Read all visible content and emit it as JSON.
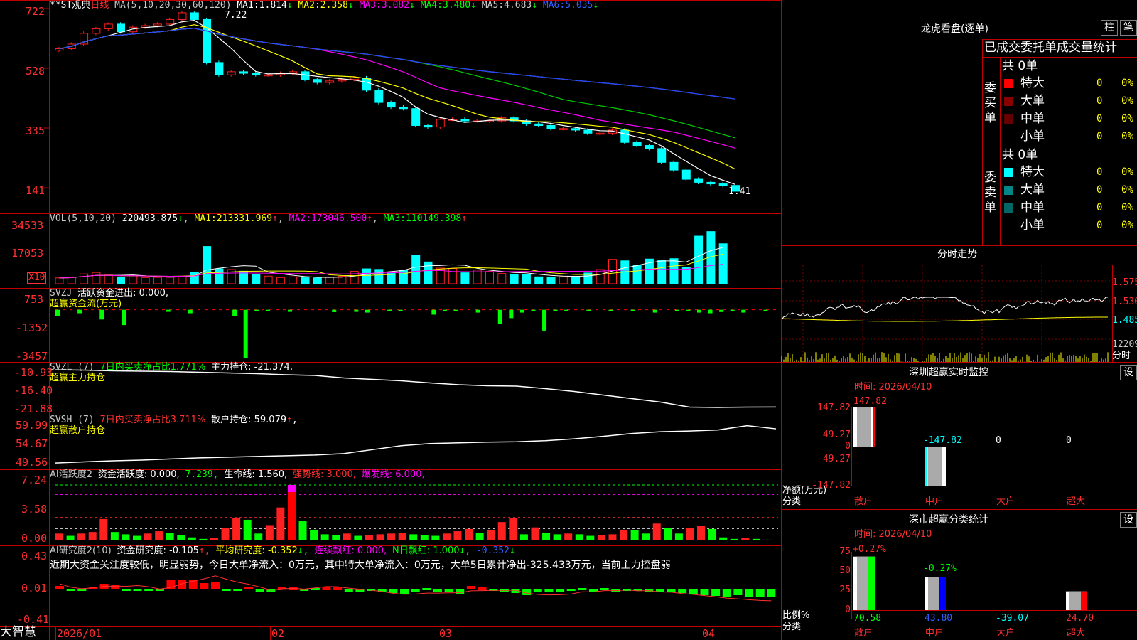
{
  "colors": {
    "up": "#ff2020",
    "down": "#00ffff",
    "vol_down": "#00ffff",
    "ma1": "#ffffff",
    "ma2": "#ffff00",
    "ma3": "#ff00ff",
    "ma4": "#00cc00",
    "ma5": "#c0c0c0",
    "ma6": "#2040ff",
    "grid": "#b00000",
    "pos": "#ff0000",
    "neg": "#00ff00"
  },
  "price_panel": {
    "stock": "**ST观典",
    "period": "日线",
    "ma_params": "MA(5,10,20,30,60,120)",
    "ma": [
      {
        "label": "MA1:",
        "value": "1.814",
        "arrow": "↓"
      },
      {
        "label": "MA2:",
        "value": "2.358",
        "arrow": "↓"
      },
      {
        "label": "MA3:",
        "value": "3.082",
        "arrow": "↓"
      },
      {
        "label": "MA4:",
        "value": "3.480",
        "arrow": "↓"
      },
      {
        "label": "MA5:",
        "value": "4.683",
        "arrow": "↓"
      },
      {
        "label": "MA6:",
        "value": "5.035",
        "arrow": "↓"
      }
    ],
    "y_ticks": [
      "722",
      "528",
      "335",
      "141"
    ],
    "high_label": "7.22",
    "low_label": "1.41"
  },
  "vol_panel": {
    "label": "VOL(5,10,20)",
    "value": "220493.875",
    "value_arrow": "↓",
    "ma": [
      {
        "label": "MA1:",
        "value": "213331.969",
        "arrow": "↑"
      },
      {
        "label": "MA2:",
        "value": "173046.500",
        "arrow": "↑"
      },
      {
        "label": "MA3:",
        "value": "110149.398",
        "arrow": "↑"
      }
    ],
    "y_ticks": [
      "34533",
      "17053"
    ],
    "unit": "X10"
  },
  "svzj_panel": {
    "label": "SVZJ",
    "text": "活跃资金进出: 0.000,",
    "sub": "超赢资金流(万元)",
    "y_ticks": [
      "753",
      "-1352",
      "-3457"
    ]
  },
  "svzl_panel": {
    "label": "SVZL (7)",
    "text1": "7日内买卖净占比1.771%",
    "text2": "主力持仓: -21.374,",
    "sub": "超赢主力持仓",
    "y_ticks": [
      "-10.93",
      "-16.40",
      "-21.88"
    ]
  },
  "svsh_panel": {
    "label": "SVSH (7)",
    "text1": "7日内买卖净占比3.711%",
    "text2": "散户持仓: 59.079",
    "arrow": "↑",
    "comma": ",",
    "sub": "超赢散户持仓",
    "y_ticks": [
      "59.99",
      "54.67",
      "49.56"
    ]
  },
  "ai_active_panel": {
    "label": "AI活跃度2",
    "t1": "资金活跃度: 0.000,",
    "t2": "7.239,",
    "t3": "生命线: 1.560,",
    "t4": "强势线: 3.000,",
    "t5": "爆发线: 6.000,",
    "y_ticks": [
      "7.24",
      "3.58",
      "0.00"
    ]
  },
  "ai_research_panel": {
    "label": "AI研究度2(10)",
    "t1": "资金研究度: -0.105",
    "t1a": "↑,",
    "t2": "平均研究度: -0.352",
    "t2a": "↓,",
    "t3": "连续飘红: 0.000,",
    "t4": "N日飘红: 1.000",
    "t4a": "↓,",
    "t5": "-0.352",
    "t5a": "↓",
    "comment": "近期大资金关注度较低，明显弱势，今日大单净流入：0万元，其中特大单净流入：0万元，大单5日累计净出-325.433万元，当前主力控盘弱",
    "y_ticks": [
      "0.43",
      "0.01",
      "-0.41"
    ]
  },
  "x_axis": {
    "labels": [
      "2026/01",
      "02",
      "03",
      "04"
    ]
  },
  "logo": "大智慧",
  "lhb": {
    "title": "龙虎看盘(逐单)",
    "btn1": "柱",
    "btn2": "笔",
    "header": "已成交委托单成交量统计",
    "buy": {
      "side": "委买单",
      "total": "共 0单",
      "rows": [
        {
          "name": "特大",
          "count": "0",
          "pct": "0%",
          "color": "#ff0000"
        },
        {
          "name": "大单",
          "count": "0",
          "pct": "0%",
          "color": "#880000"
        },
        {
          "name": "中单",
          "count": "0",
          "pct": "0%",
          "color": "#660000"
        },
        {
          "name": "小单",
          "count": "0",
          "pct": "0%",
          "color": ""
        }
      ]
    },
    "sell": {
      "side": "委卖单",
      "total": "共 0单",
      "rows": [
        {
          "name": "特大",
          "count": "0",
          "pct": "0%",
          "color": "#00ffff"
        },
        {
          "name": "大单",
          "count": "0",
          "pct": "0%",
          "color": "#008888"
        },
        {
          "name": "中单",
          "count": "0",
          "pct": "0%",
          "color": "#006666"
        },
        {
          "name": "小单",
          "count": "0",
          "pct": "0%",
          "color": ""
        }
      ]
    }
  },
  "intraday": {
    "title": "分时走势",
    "price_ticks": [
      "1.575",
      "1.530",
      "1.485"
    ],
    "vol_label": "12209",
    "unit": "分时"
  },
  "monitor": {
    "title": "深圳超赢实时监控",
    "btn": "设",
    "time": "时间: 2026/04/10",
    "y_ticks": [
      "147.82",
      "49.27",
      "0",
      "-49.27",
      "-147.82"
    ],
    "ylabel": "净额(万元)",
    "xlabel": "分类",
    "categories": [
      "散户",
      "中户",
      "大户",
      "超大"
    ],
    "values": [
      147.82,
      -147.82,
      0,
      0
    ],
    "value_labels": [
      "147.82",
      "-147.82",
      "0",
      "0"
    ]
  },
  "classify": {
    "title": "深市超赢分类统计",
    "btn": "设",
    "time": "时间: 2026/04/10",
    "y_ticks": [
      "75",
      "50",
      "25",
      "0"
    ],
    "ylabel": "比例%",
    "xlabel": "分类",
    "categories": [
      "散户",
      "中户",
      "大户",
      "超大"
    ],
    "values": [
      70.58,
      43.8,
      -39.07,
      24.7
    ],
    "value_labels": [
      "70.58",
      "43.80",
      "-39.07",
      "24.70"
    ],
    "top_labels": [
      "+0.27%",
      "-0.27%"
    ]
  },
  "chart_data": [
    {
      "type": "candlestick",
      "title": "**ST观典 日线",
      "x": [
        "2026/01",
        "02",
        "03",
        "04"
      ],
      "close": [
        6.05,
        6.2,
        6.55,
        6.7,
        6.85,
        6.6,
        6.75,
        6.8,
        6.85,
        7.0,
        7.22,
        7.0,
        5.6,
        5.2,
        5.3,
        5.25,
        5.2,
        5.2,
        5.25,
        5.3,
        5.05,
        4.95,
        5.0,
        5.05,
        5.1,
        4.7,
        4.3,
        4.15,
        4.1,
        3.55,
        3.5,
        3.75,
        3.75,
        3.7,
        3.7,
        3.7,
        3.8,
        3.7,
        3.6,
        3.55,
        3.45,
        3.45,
        3.4,
        3.3,
        3.3,
        3.4,
        3.0,
        2.9,
        2.8,
        2.35,
        2.1,
        1.8,
        1.7,
        1.65,
        1.6,
        1.41
      ],
      "ylim": [
        1.2,
        7.45
      ],
      "y_ticks": [
        "722",
        "528",
        "335",
        "141"
      ]
    },
    {
      "type": "bar",
      "title": "VOL(5,10,20)",
      "values": [
        3200,
        3500,
        5400,
        6200,
        4800,
        3400,
        4300,
        3400,
        3500,
        3600,
        4000,
        6200,
        20500,
        8200,
        7800,
        6900,
        5100,
        4200,
        3400,
        3800,
        3300,
        3200,
        3600,
        4100,
        6800,
        8200,
        7900,
        6400,
        7300,
        15800,
        12000,
        8600,
        8400,
        6000,
        7500,
        6800,
        5600,
        4900,
        5000,
        3800,
        3600,
        3800,
        4100,
        5900,
        7800,
        13400,
        12600,
        10200,
        13600,
        12800,
        13800,
        9200,
        26200,
        28700,
        22000
      ],
      "ylim": [
        0,
        36000
      ]
    },
    {
      "type": "bar",
      "title": "SVZJ",
      "values": [
        -480,
        0,
        -250,
        0,
        -700,
        0,
        -1100,
        0,
        0,
        0,
        -150,
        0,
        -250,
        0,
        0,
        0,
        -450,
        -3457,
        -120,
        -120,
        0,
        -150,
        0,
        0,
        0,
        -170,
        0,
        -150,
        -200,
        0,
        -120,
        -120,
        0,
        0,
        -350,
        -120,
        -80,
        0,
        -200,
        0,
        -1000,
        -600,
        -200,
        -120,
        -1500,
        -120,
        -120,
        0,
        -100,
        0,
        -100,
        0,
        -120,
        0,
        -200,
        0,
        -120,
        -100,
        -200,
        -250,
        -160,
        -80,
        -200,
        0,
        -120
      ],
      "ylim": [
        -3457,
        753
      ]
    },
    {
      "type": "line",
      "title": "SVZL",
      "values": [
        -10.93,
        -11.0,
        -11.2,
        -11.3,
        -11.4,
        -11.6,
        -11.8,
        -12.0,
        -12.3,
        -12.5,
        -13.2,
        -13.6,
        -14.0,
        -14.6,
        -15.1,
        -15.4,
        -15.5,
        -16.2,
        -17.0,
        -18.0,
        -19.0,
        -20.0,
        -21.4,
        -21.5,
        -21.4,
        -21.37
      ],
      "ylim": [
        -22.5,
        -10.5
      ]
    },
    {
      "type": "line",
      "title": "SVSH",
      "values": [
        49.56,
        49.9,
        50.2,
        50.4,
        50.7,
        51.0,
        51.2,
        51.4,
        51.6,
        51.8,
        52.2,
        53.3,
        54.4,
        55.0,
        55.2,
        55.4,
        55.5,
        55.8,
        56.3,
        57.0,
        57.8,
        58.3,
        58.5,
        58.8,
        59.99,
        59.1
      ],
      "ylim": [
        49.0,
        60.5
      ]
    },
    {
      "type": "bar",
      "title": "AI活跃度2",
      "values": [
        0.9,
        0.6,
        0.9,
        1.1,
        2.8,
        1.1,
        0.8,
        0.6,
        0.9,
        1.2,
        1.0,
        0.7,
        0.4,
        0.2,
        0.3,
        1.6,
        2.9,
        2.7,
        0.9,
        2.0,
        4.3,
        7.24,
        2.6,
        1.4,
        0.8,
        0.7,
        0.9,
        0.6,
        0.7,
        0.8,
        0.9,
        1.0,
        0.8,
        0.7,
        0.6,
        0.9,
        1.2,
        1.5,
        1.0,
        1.3,
        2.4,
        2.9,
        0.8,
        1.7,
        1.0,
        0.8,
        0.9,
        0.8,
        0.6,
        0.7,
        0.8,
        1.4,
        1.3,
        0.9,
        2.2,
        1.6,
        0.9,
        1.6,
        1.9,
        1.5,
        0.4,
        0.2,
        0.3,
        0.2,
        0.1
      ],
      "ylim": [
        0,
        7.8
      ]
    },
    {
      "type": "bar",
      "title": "AI研究度2(10)",
      "values": [
        0.05,
        -0.01,
        -0.02,
        0.04,
        0.08,
        0.06,
        -0.02,
        0.01,
        -0.01,
        -0.02,
        0.13,
        0.14,
        0.13,
        0.09,
        0.11,
        -0.02,
        0.01,
        0.04,
        -0.03,
        -0.03,
        0.04,
        0.03,
        0.01,
        0.02,
        0.03,
        0.03,
        -0.03,
        -0.04,
        -0.02,
        -0.03,
        -0.05,
        -0.07,
        -0.03,
        0.02,
        -0.03,
        -0.04,
        -0.06,
        0.05,
        0.03,
        -0.02,
        -0.04,
        -0.05,
        -0.08,
        -0.03,
        -0.04,
        -0.03,
        -0.02,
        0.02,
        -0.04,
        0.02,
        -0.03,
        0.01,
        -0.02,
        -0.03,
        -0.04,
        -0.04,
        -0.05,
        -0.06,
        -0.08,
        -0.09,
        -0.1,
        -0.08,
        -0.1,
        -0.11,
        -0.105
      ],
      "ylim": [
        -0.45,
        0.45
      ]
    }
  ]
}
